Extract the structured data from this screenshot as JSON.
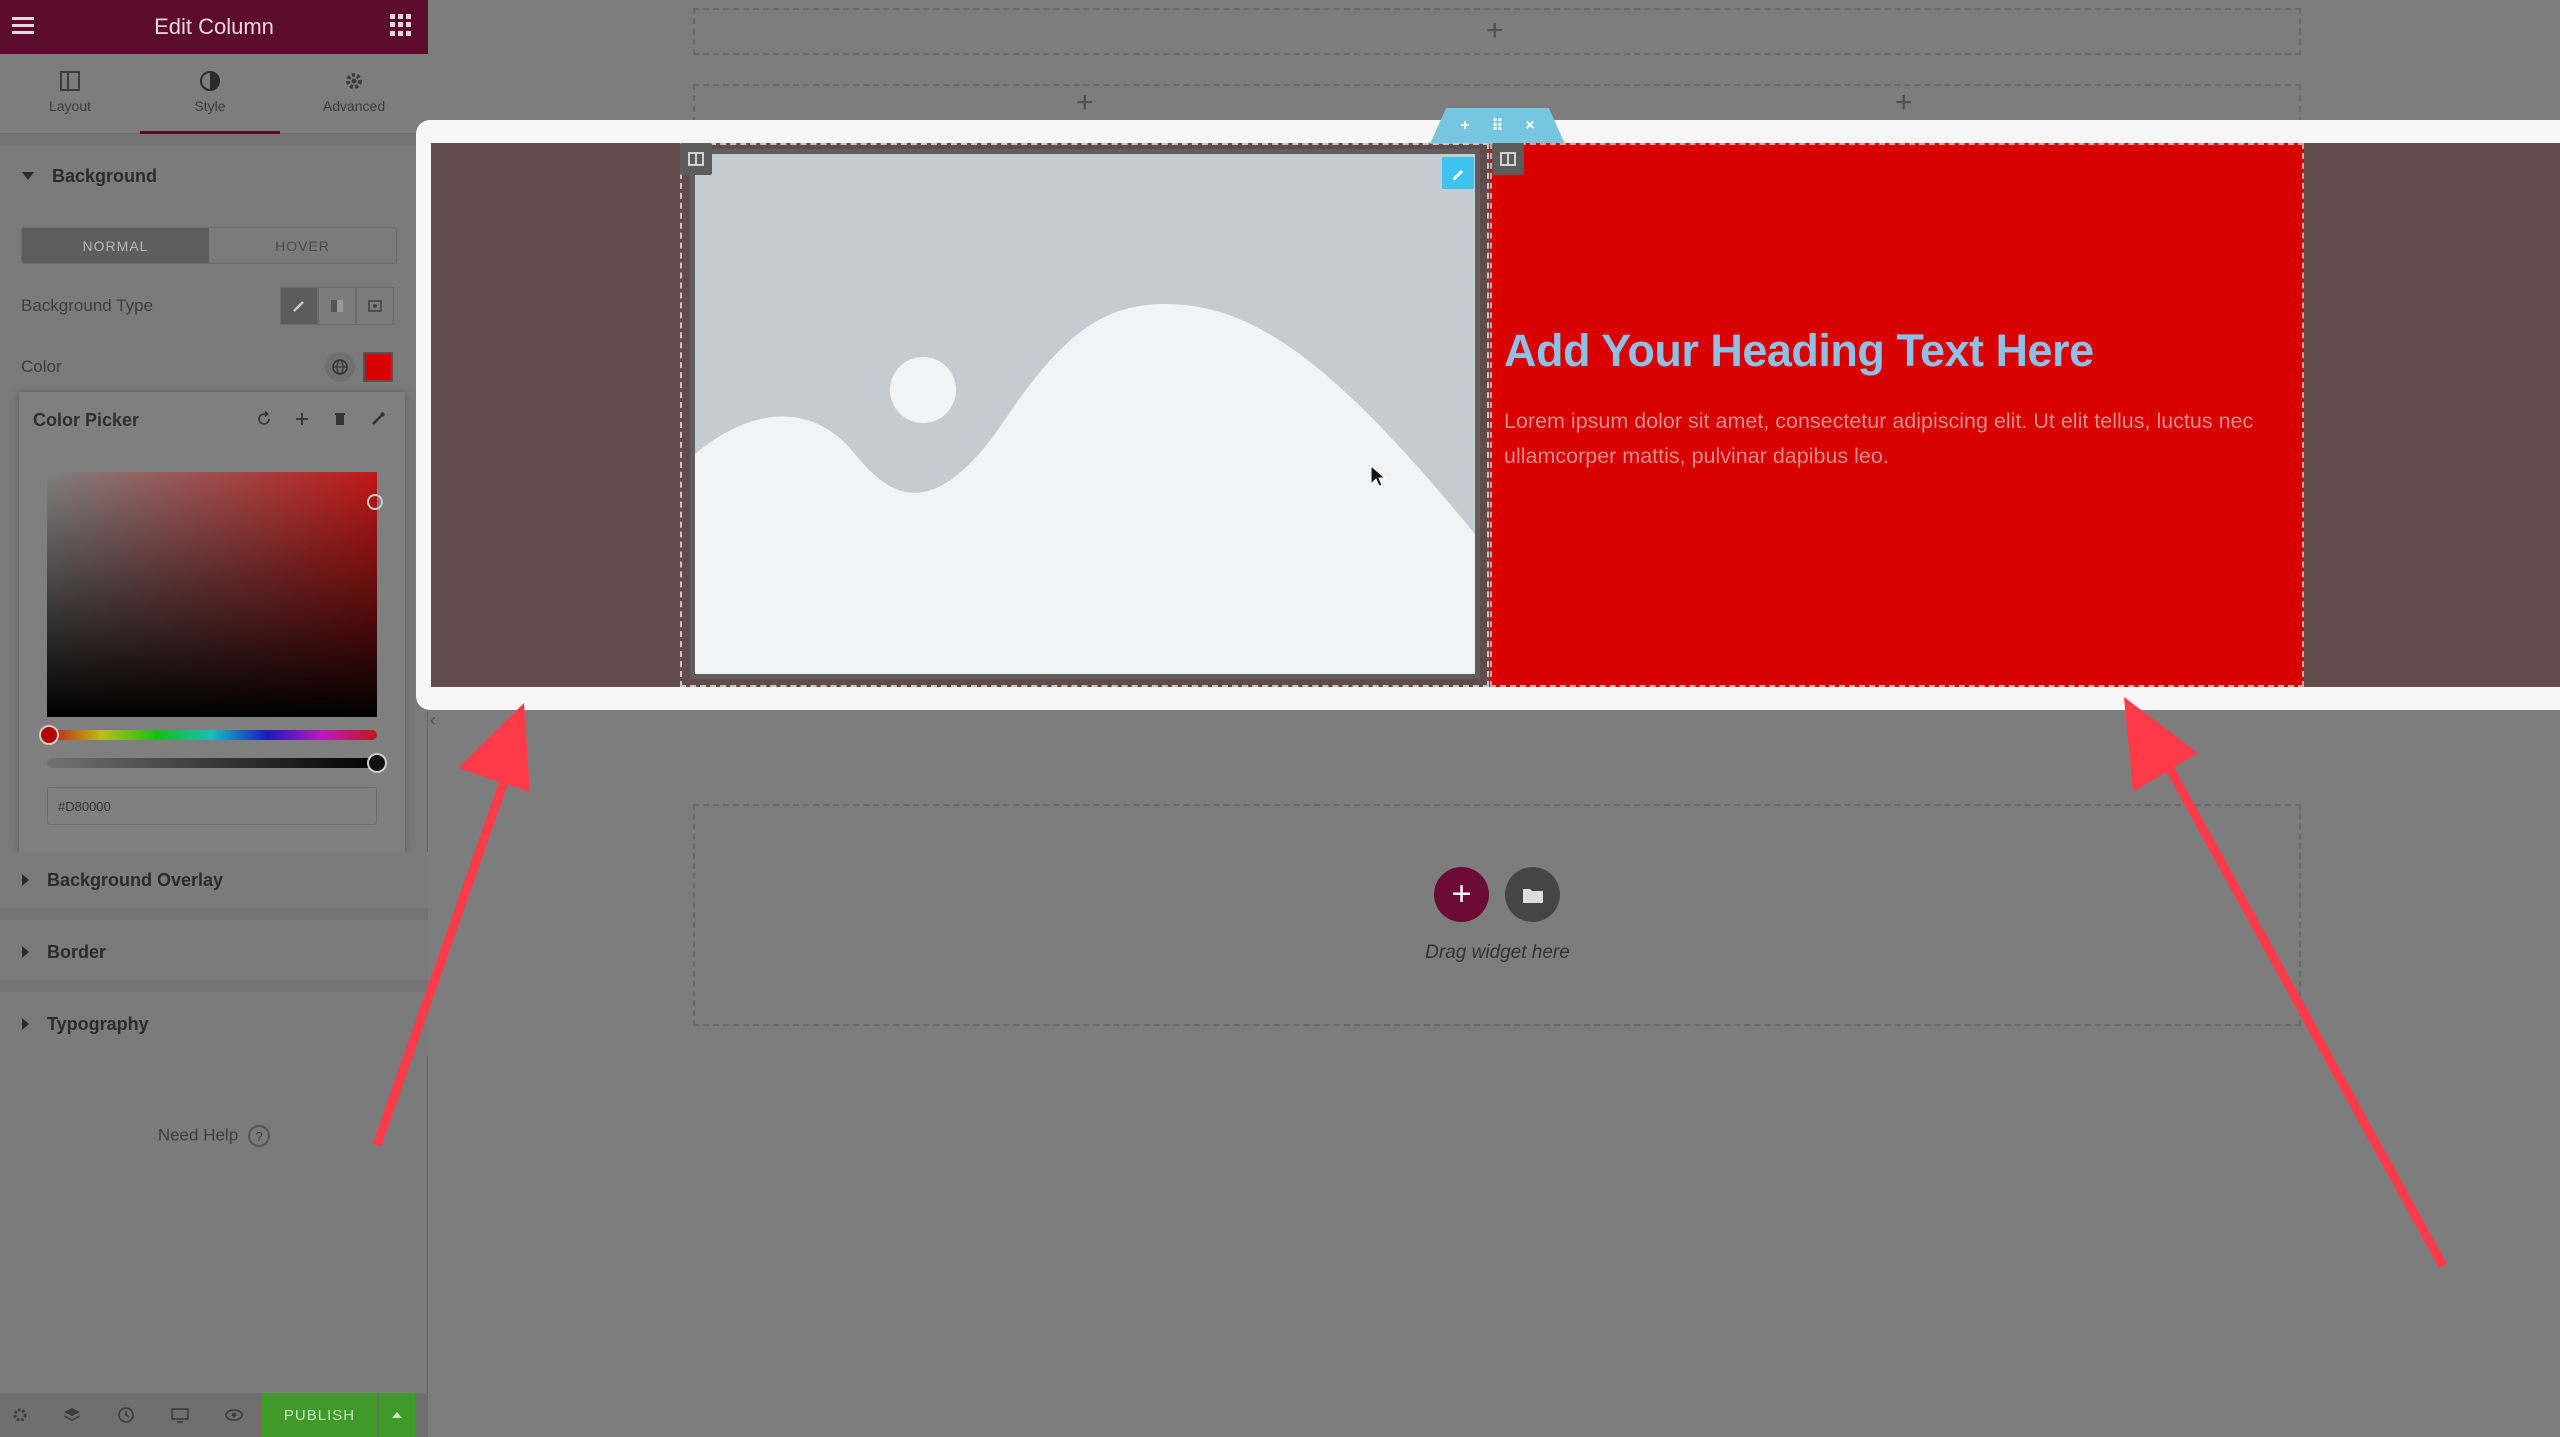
{
  "sidebar": {
    "header_title": "Edit Column",
    "tabs": [
      {
        "label": "Layout",
        "icon": "layout-icon"
      },
      {
        "label": "Style",
        "icon": "style-icon",
        "active": true
      },
      {
        "label": "Advanced",
        "icon": "gear-icon"
      }
    ],
    "background_section": {
      "title": "Background",
      "state_tabs": [
        "NORMAL",
        "HOVER"
      ],
      "background_type_label": "Background Type",
      "color_label": "Color",
      "color_value": "#D80000"
    },
    "color_picker": {
      "title": "Color Picker",
      "hex_value": "#D80000"
    },
    "sections": [
      "Background Overlay",
      "Border",
      "Typography"
    ],
    "need_help": "Need Help",
    "help_icon_glyph": "?",
    "publish_label": "PUBLISH"
  },
  "canvas": {
    "heading": "Add Your Heading Text Here",
    "body_text": "Lorem ipsum dolor sit amet, consectetur adipiscing elit. Ut elit tellus, luctus nec ullamcorper mattis, pulvinar dapibus leo.",
    "drag_widget_text": "Drag widget here",
    "right_column_bg": "#D80000",
    "section_bg": "#634B4B"
  },
  "colors": {
    "brand": "#5C0A2E",
    "publish": "#3F9A2A",
    "handle": "#77C6DF",
    "annotation_arrow": "#FF3B4A"
  }
}
